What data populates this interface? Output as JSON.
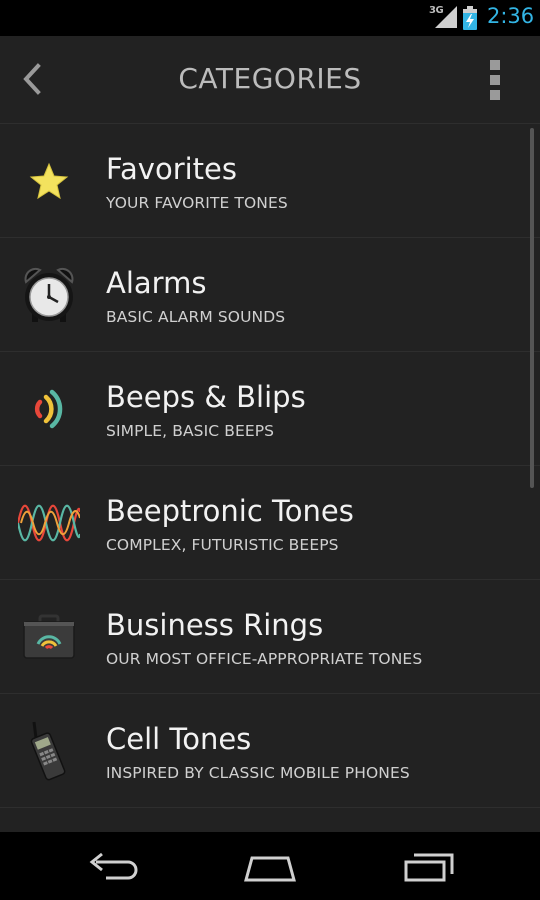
{
  "status_bar": {
    "network": "3G",
    "time": "2:36"
  },
  "action_bar": {
    "title": "CATEGORIES"
  },
  "categories": [
    {
      "title": "Favorites",
      "subtitle": "YOUR FAVORITE TONES",
      "icon": "star-icon"
    },
    {
      "title": "Alarms",
      "subtitle": "BASIC ALARM SOUNDS",
      "icon": "alarm-clock-icon"
    },
    {
      "title": "Beeps & Blips",
      "subtitle": "SIMPLE, BASIC BEEPS",
      "icon": "sound-waves-icon"
    },
    {
      "title": "Beeptronic Tones",
      "subtitle": "COMPLEX, FUTURISTIC BEEPS",
      "icon": "waveform-icon"
    },
    {
      "title": "Business Rings",
      "subtitle": "OUR MOST OFFICE-APPROPRIATE TONES",
      "icon": "briefcase-icon"
    },
    {
      "title": "Cell Tones",
      "subtitle": "INSPIRED BY CLASSIC MOBILE PHONES",
      "icon": "cell-phone-icon"
    }
  ],
  "colors": {
    "accent": "#33b5e5",
    "background": "#222222",
    "star": "#f3e25e"
  }
}
